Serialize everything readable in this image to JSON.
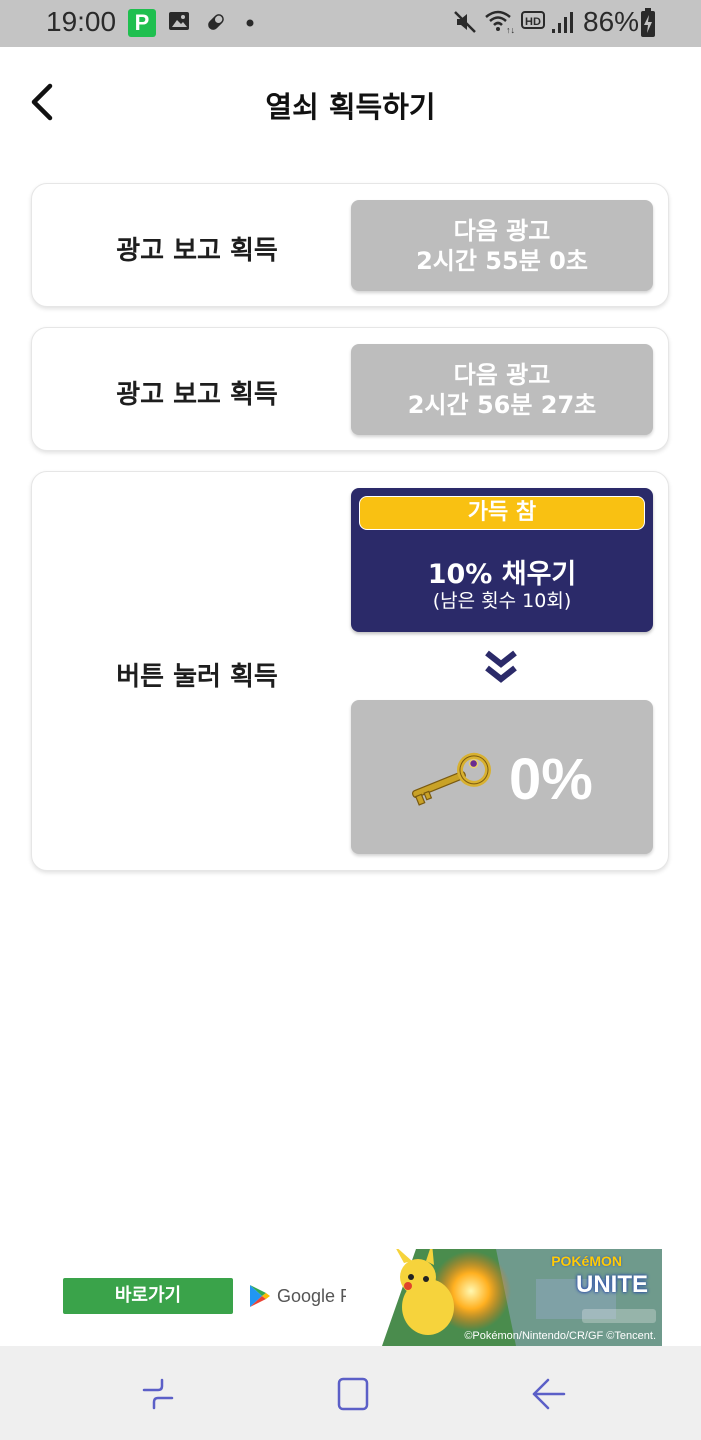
{
  "status_bar": {
    "time": "19:00",
    "notification_icons": [
      "p-app-icon",
      "image-icon",
      "pill-icon",
      "dot-icon"
    ],
    "system_icons": [
      "mute-icon",
      "wifi-icon",
      "hd-icon",
      "signal-icon",
      "battery-charging-icon"
    ],
    "battery": "86%"
  },
  "header": {
    "title": "열쇠 획득하기",
    "back_icon": "chevron-left-icon"
  },
  "cards": [
    {
      "label": "광고 보고 획득",
      "button_line1": "다음 광고",
      "button_line2": "2시간 55분 0초"
    },
    {
      "label": "광고 보고 획득",
      "button_line1": "다음 광고",
      "button_line2": "2시간 56분 27초"
    }
  ],
  "fill_card": {
    "label": "버튼 눌러 획득",
    "badge": "가득 참",
    "button_title": "10% 채우기",
    "button_sub": "(남은 횟수 10회)",
    "arrow_icon": "double-chevron-down-icon",
    "key_icon": "golden-key-icon",
    "progress": "0%"
  },
  "ad": {
    "cta": "바로가기",
    "store": "Google Play",
    "game_brand_top": "POKéMON",
    "game_brand": "UNITE",
    "copyright": "©Pokémon/Nintendo/CR/GF ©Tencent."
  },
  "colors": {
    "fill_button": "#2b2a69",
    "badge": "#f9c112",
    "gray_button": "#bdbdbd",
    "ad_cta": "#3aa34a",
    "nav_icon": "#5b5fc7"
  },
  "nav_bar": {
    "icons": [
      "recent-apps-icon",
      "home-icon",
      "back-icon"
    ]
  }
}
